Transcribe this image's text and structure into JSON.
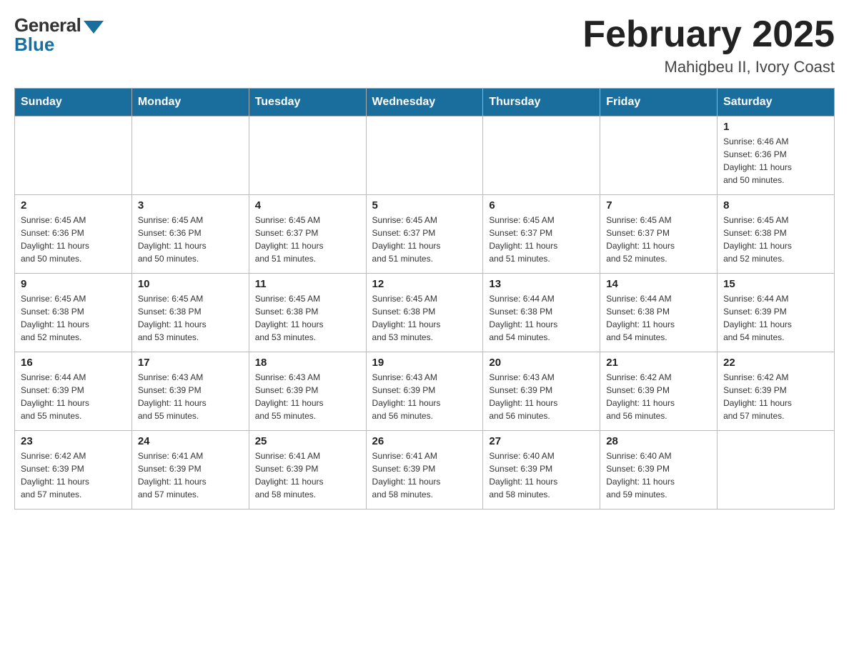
{
  "logo": {
    "general": "General",
    "blue": "Blue",
    "arrow_color": "#1a6e9e"
  },
  "header": {
    "title": "February 2025",
    "subtitle": "Mahigbeu II, Ivory Coast"
  },
  "days_of_week": [
    "Sunday",
    "Monday",
    "Tuesday",
    "Wednesday",
    "Thursday",
    "Friday",
    "Saturday"
  ],
  "weeks": [
    [
      {
        "day": "",
        "info": ""
      },
      {
        "day": "",
        "info": ""
      },
      {
        "day": "",
        "info": ""
      },
      {
        "day": "",
        "info": ""
      },
      {
        "day": "",
        "info": ""
      },
      {
        "day": "",
        "info": ""
      },
      {
        "day": "1",
        "info": "Sunrise: 6:46 AM\nSunset: 6:36 PM\nDaylight: 11 hours\nand 50 minutes."
      }
    ],
    [
      {
        "day": "2",
        "info": "Sunrise: 6:45 AM\nSunset: 6:36 PM\nDaylight: 11 hours\nand 50 minutes."
      },
      {
        "day": "3",
        "info": "Sunrise: 6:45 AM\nSunset: 6:36 PM\nDaylight: 11 hours\nand 50 minutes."
      },
      {
        "day": "4",
        "info": "Sunrise: 6:45 AM\nSunset: 6:37 PM\nDaylight: 11 hours\nand 51 minutes."
      },
      {
        "day": "5",
        "info": "Sunrise: 6:45 AM\nSunset: 6:37 PM\nDaylight: 11 hours\nand 51 minutes."
      },
      {
        "day": "6",
        "info": "Sunrise: 6:45 AM\nSunset: 6:37 PM\nDaylight: 11 hours\nand 51 minutes."
      },
      {
        "day": "7",
        "info": "Sunrise: 6:45 AM\nSunset: 6:37 PM\nDaylight: 11 hours\nand 52 minutes."
      },
      {
        "day": "8",
        "info": "Sunrise: 6:45 AM\nSunset: 6:38 PM\nDaylight: 11 hours\nand 52 minutes."
      }
    ],
    [
      {
        "day": "9",
        "info": "Sunrise: 6:45 AM\nSunset: 6:38 PM\nDaylight: 11 hours\nand 52 minutes."
      },
      {
        "day": "10",
        "info": "Sunrise: 6:45 AM\nSunset: 6:38 PM\nDaylight: 11 hours\nand 53 minutes."
      },
      {
        "day": "11",
        "info": "Sunrise: 6:45 AM\nSunset: 6:38 PM\nDaylight: 11 hours\nand 53 minutes."
      },
      {
        "day": "12",
        "info": "Sunrise: 6:45 AM\nSunset: 6:38 PM\nDaylight: 11 hours\nand 53 minutes."
      },
      {
        "day": "13",
        "info": "Sunrise: 6:44 AM\nSunset: 6:38 PM\nDaylight: 11 hours\nand 54 minutes."
      },
      {
        "day": "14",
        "info": "Sunrise: 6:44 AM\nSunset: 6:38 PM\nDaylight: 11 hours\nand 54 minutes."
      },
      {
        "day": "15",
        "info": "Sunrise: 6:44 AM\nSunset: 6:39 PM\nDaylight: 11 hours\nand 54 minutes."
      }
    ],
    [
      {
        "day": "16",
        "info": "Sunrise: 6:44 AM\nSunset: 6:39 PM\nDaylight: 11 hours\nand 55 minutes."
      },
      {
        "day": "17",
        "info": "Sunrise: 6:43 AM\nSunset: 6:39 PM\nDaylight: 11 hours\nand 55 minutes."
      },
      {
        "day": "18",
        "info": "Sunrise: 6:43 AM\nSunset: 6:39 PM\nDaylight: 11 hours\nand 55 minutes."
      },
      {
        "day": "19",
        "info": "Sunrise: 6:43 AM\nSunset: 6:39 PM\nDaylight: 11 hours\nand 56 minutes."
      },
      {
        "day": "20",
        "info": "Sunrise: 6:43 AM\nSunset: 6:39 PM\nDaylight: 11 hours\nand 56 minutes."
      },
      {
        "day": "21",
        "info": "Sunrise: 6:42 AM\nSunset: 6:39 PM\nDaylight: 11 hours\nand 56 minutes."
      },
      {
        "day": "22",
        "info": "Sunrise: 6:42 AM\nSunset: 6:39 PM\nDaylight: 11 hours\nand 57 minutes."
      }
    ],
    [
      {
        "day": "23",
        "info": "Sunrise: 6:42 AM\nSunset: 6:39 PM\nDaylight: 11 hours\nand 57 minutes."
      },
      {
        "day": "24",
        "info": "Sunrise: 6:41 AM\nSunset: 6:39 PM\nDaylight: 11 hours\nand 57 minutes."
      },
      {
        "day": "25",
        "info": "Sunrise: 6:41 AM\nSunset: 6:39 PM\nDaylight: 11 hours\nand 58 minutes."
      },
      {
        "day": "26",
        "info": "Sunrise: 6:41 AM\nSunset: 6:39 PM\nDaylight: 11 hours\nand 58 minutes."
      },
      {
        "day": "27",
        "info": "Sunrise: 6:40 AM\nSunset: 6:39 PM\nDaylight: 11 hours\nand 58 minutes."
      },
      {
        "day": "28",
        "info": "Sunrise: 6:40 AM\nSunset: 6:39 PM\nDaylight: 11 hours\nand 59 minutes."
      },
      {
        "day": "",
        "info": ""
      }
    ]
  ]
}
